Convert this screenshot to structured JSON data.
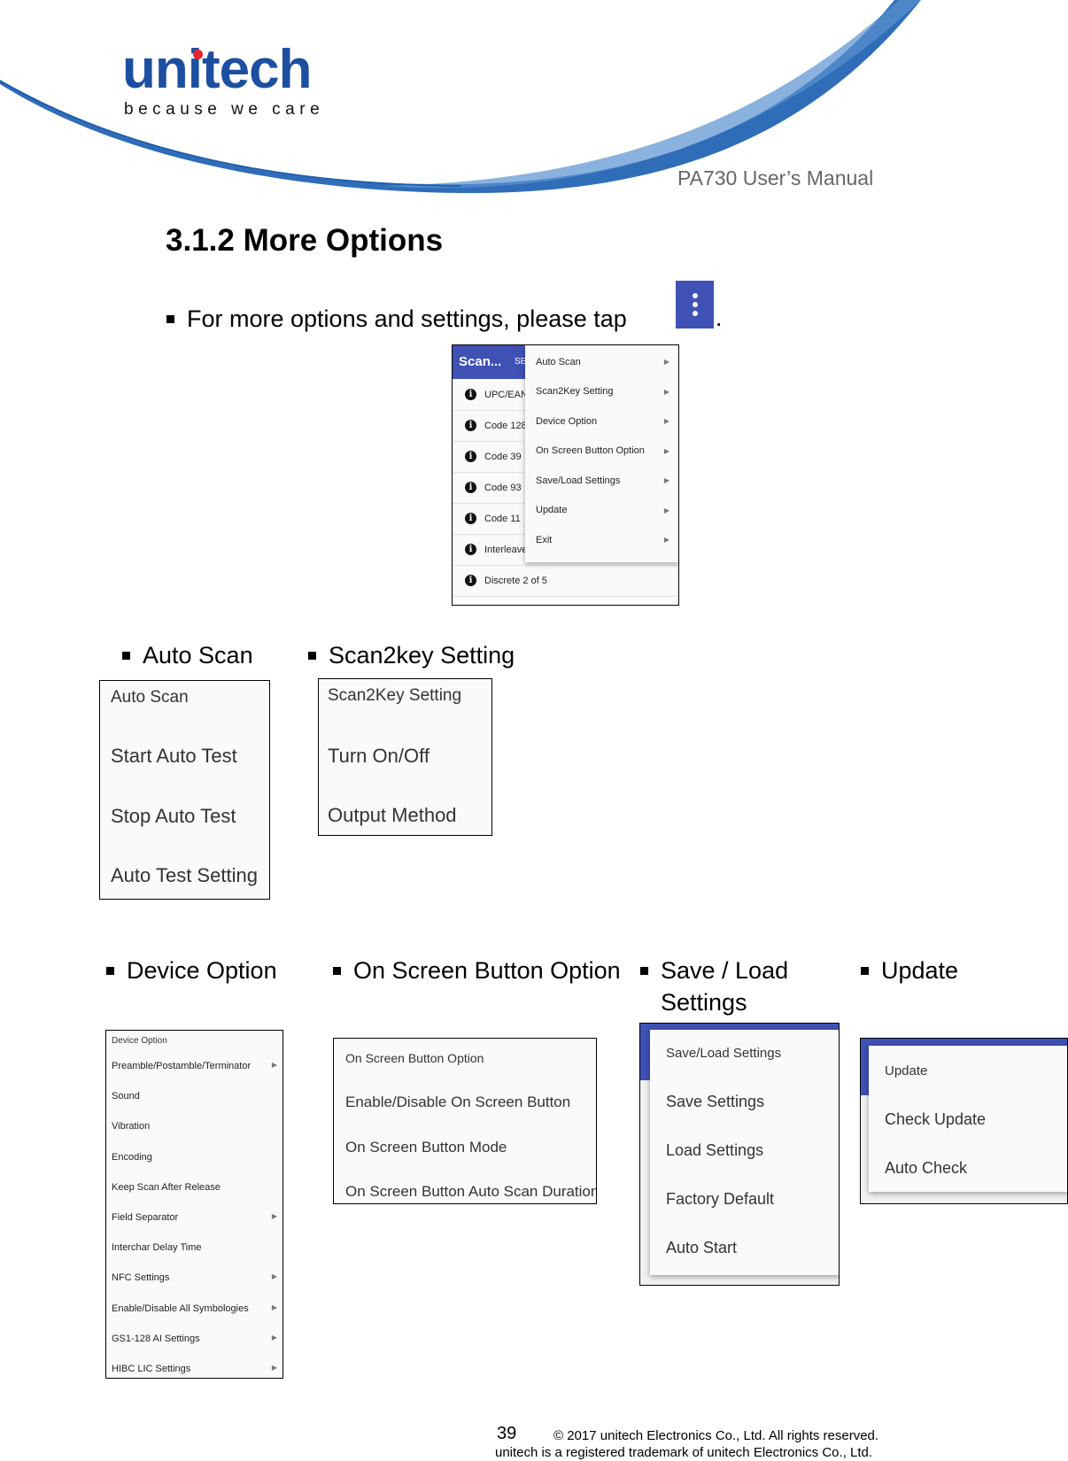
{
  "header": {
    "logo_text": "unitech",
    "logo_tagline": "because we care",
    "manual_title": "PA730 User’s Manual",
    "colors": {
      "brand_blue": "#1d4fa0",
      "logo_dot": "#e5242b",
      "app_bar": "#3f51b5"
    }
  },
  "section": {
    "title": "3.1.2 More Options",
    "intro": "For more options and settings, please tap",
    "intro_end": ".",
    "tap_icon": "more-vert-icon"
  },
  "main_screenshot": {
    "app_title": "Scan...",
    "app_subtitle": "SE",
    "background_rows": [
      "UPC/EAN",
      "Code 128",
      "Code 39",
      "Code 93",
      "Code 11",
      "Interleave",
      "Discrete 2 of 5"
    ],
    "menu_items": [
      "Auto Scan",
      "Scan2Key Setting",
      "Device Option",
      "On Screen Button Option",
      "Save/Load Settings",
      "Update",
      "Exit"
    ]
  },
  "auto_scan": {
    "label": "Auto Scan",
    "panel_title": "Auto Scan",
    "items": [
      "Start Auto Test",
      "Stop Auto Test",
      "Auto Test Setting"
    ]
  },
  "scan2key": {
    "label": "Scan2key Setting",
    "panel_title": "Scan2Key Setting",
    "items": [
      "Turn On/Off",
      "Output Method"
    ]
  },
  "device_option": {
    "label": "Device Option",
    "panel_title": "Device Option",
    "items": [
      {
        "text": "Preamble/Postamble/Terminator",
        "submenu": true
      },
      {
        "text": "Sound",
        "submenu": false
      },
      {
        "text": "Vibration",
        "submenu": false
      },
      {
        "text": "Encoding",
        "submenu": false
      },
      {
        "text": "Keep Scan After Release",
        "submenu": false
      },
      {
        "text": "Field Separator",
        "submenu": true
      },
      {
        "text": "Interchar Delay Time",
        "submenu": false
      },
      {
        "text": "NFC Settings",
        "submenu": true
      },
      {
        "text": "Enable/Disable All Symbologies",
        "submenu": true
      },
      {
        "text": "GS1-128 AI Settings",
        "submenu": true
      },
      {
        "text": "HIBC LIC Settings",
        "submenu": true
      }
    ]
  },
  "on_screen_button": {
    "label": "On Screen Button Option",
    "panel_title": "On Screen Button Option",
    "items": [
      "Enable/Disable On Screen Button",
      "On Screen Button Mode",
      "On Screen Button Auto Scan Duration"
    ]
  },
  "save_load": {
    "label_line1": "Save / Load",
    "label_line2": "Settings",
    "panel_title": "Save/Load Settings",
    "items": [
      "Save Settings",
      "Load Settings",
      "Factory Default",
      "Auto Start"
    ]
  },
  "update": {
    "label": "Update",
    "panel_title": "Update",
    "items": [
      "Check Update",
      "Auto Check"
    ]
  },
  "footer": {
    "page_number": "39",
    "copyright": "© 2017 unitech Electronics Co., Ltd. All rights reserved.",
    "trademark": "unitech is a registered trademark of unitech Electronics Co., Ltd."
  }
}
